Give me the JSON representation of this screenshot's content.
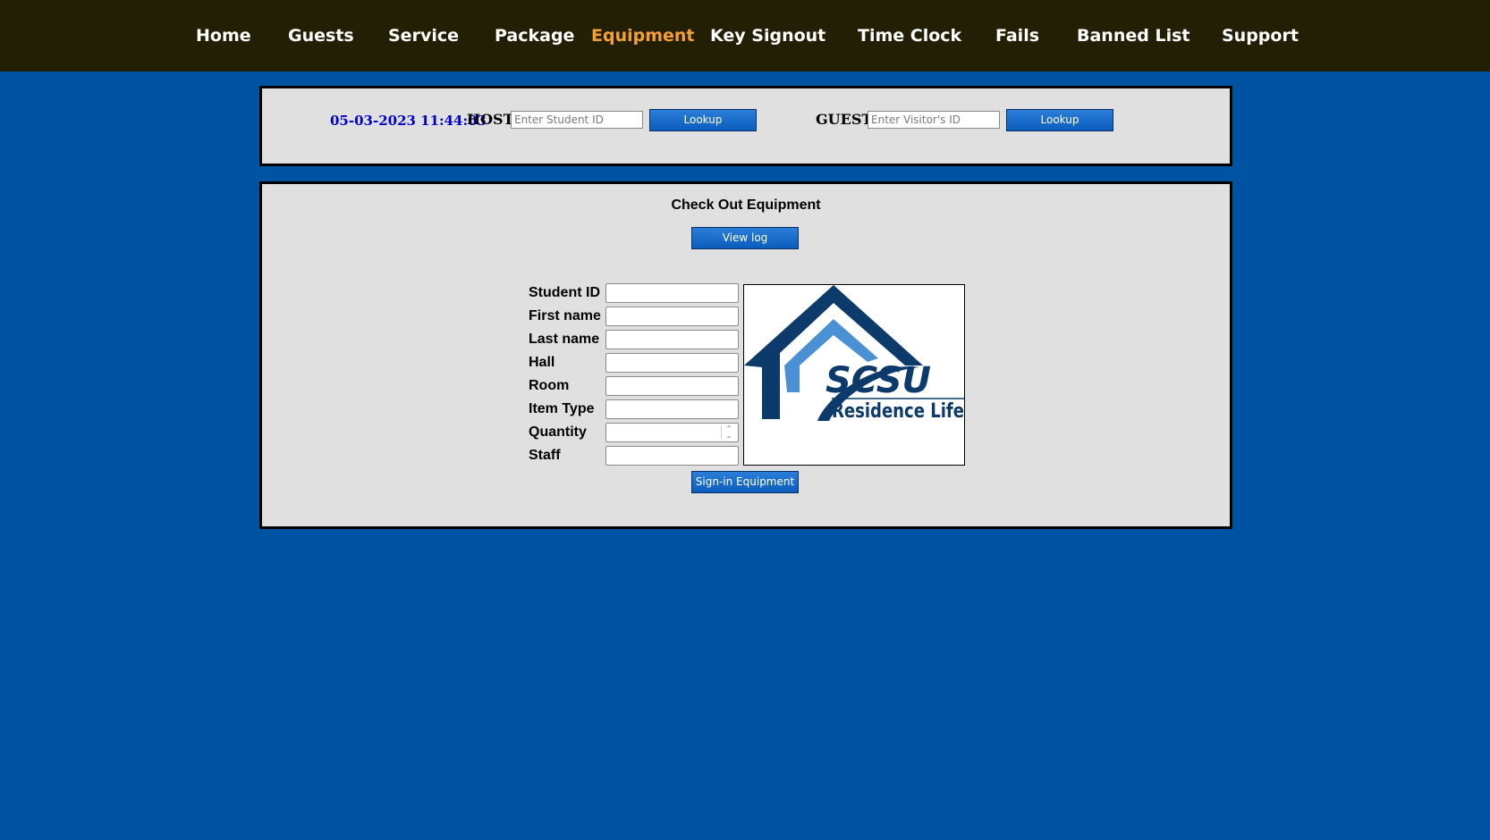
{
  "nav": {
    "items": [
      {
        "label": "Home",
        "active": false
      },
      {
        "label": "Guests",
        "active": false
      },
      {
        "label": "Service",
        "active": false
      },
      {
        "label": "Package",
        "active": false
      },
      {
        "label": "Equipment",
        "active": true
      },
      {
        "label": "Key Signout",
        "active": false
      },
      {
        "label": "Time Clock",
        "active": false
      },
      {
        "label": "Fails",
        "active": false
      },
      {
        "label": "Banned List",
        "active": false
      },
      {
        "label": "Support",
        "active": false
      }
    ]
  },
  "lookup": {
    "datetime": "05-03-2023 11:44:03",
    "host_label": "HOST",
    "host_placeholder": "Enter Student ID",
    "host_button": "Lookup",
    "guest_label": "GUEST",
    "guest_placeholder": "Enter Visitor's ID",
    "guest_button": "Lookup"
  },
  "equipment": {
    "title": "Check Out Equipment",
    "view_log_button": "View log",
    "fields": [
      {
        "label": "Student ID",
        "value": ""
      },
      {
        "label": "First name",
        "value": ""
      },
      {
        "label": "Last name",
        "value": ""
      },
      {
        "label": "Hall",
        "value": ""
      },
      {
        "label": "Room",
        "value": ""
      },
      {
        "label": "Item Type",
        "value": ""
      },
      {
        "label": "Quantity",
        "value": ""
      },
      {
        "label": "Staff",
        "value": ""
      }
    ],
    "submit_button": "Sign-in Equipment",
    "logo": {
      "primary_text": "SCSU",
      "secondary_text": "Residence Life",
      "dark_color": "#0b3a6b",
      "light_color": "#4a90d4"
    }
  },
  "colors": {
    "page_background": "#0052a3",
    "nav_background": "#231f04",
    "nav_active": "#f4a035",
    "panel_background": "#e0e0e0",
    "datetime": "#0000cc"
  }
}
